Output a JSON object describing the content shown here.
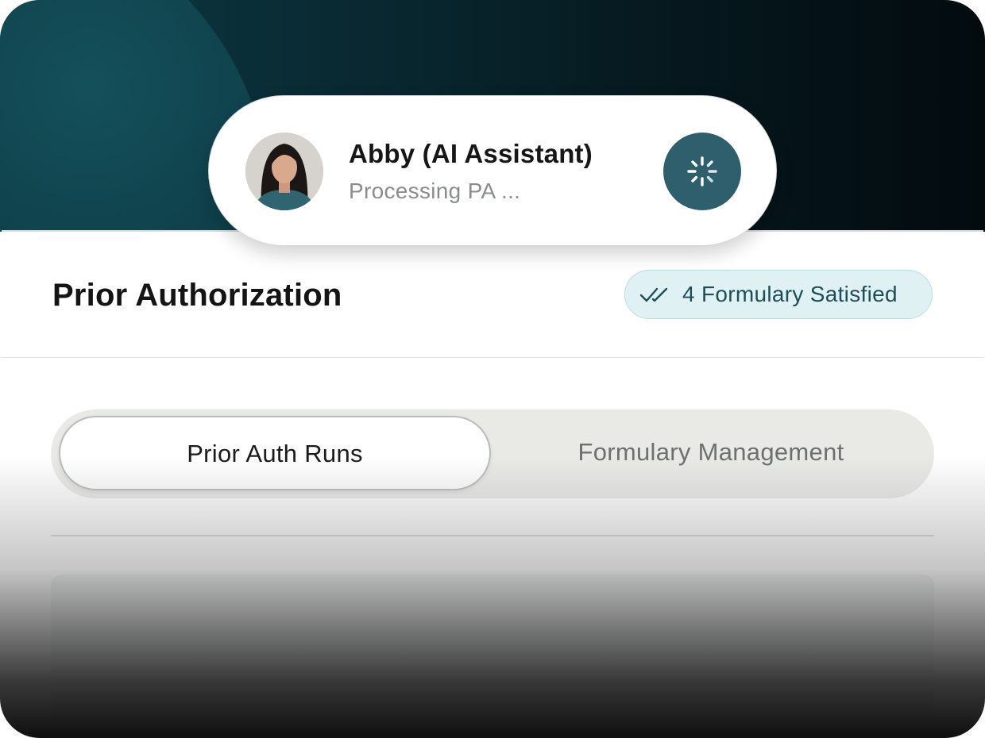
{
  "assistant": {
    "name": "Abby (AI Assistant)",
    "status": "Processing PA ...",
    "avatar_icon": "person-avatar",
    "action_icon": "loading-spinner-icon"
  },
  "header": {
    "title": "Prior Authorization",
    "badge": {
      "icon": "double-check-icon",
      "label": "4 Formulary Satisfied"
    }
  },
  "tabs": [
    {
      "label": "Prior Auth Runs",
      "active": true
    },
    {
      "label": "Formulary Management",
      "active": false
    }
  ],
  "colors": {
    "accent": "#2f5e6d",
    "badge_bg": "#dff1f3",
    "badge_text": "#1f4d57",
    "hero_dark": "#061a20"
  }
}
